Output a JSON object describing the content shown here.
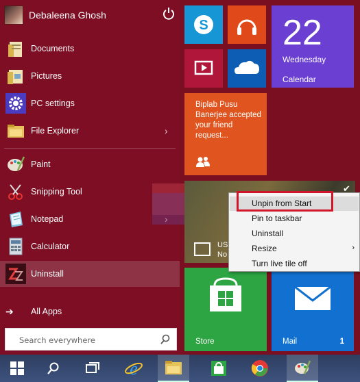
{
  "user": {
    "name": "Debaleena Ghosh"
  },
  "left_items": [
    {
      "label": "Documents",
      "icon": "documents-icon"
    },
    {
      "label": "Pictures",
      "icon": "pictures-icon"
    },
    {
      "label": "PC settings",
      "icon": "gear-icon"
    },
    {
      "label": "File Explorer",
      "icon": "file-explorer-icon"
    },
    {
      "label": "Paint",
      "icon": "paint-icon"
    },
    {
      "label": "Snipping Tool",
      "icon": "snipping-tool-icon"
    },
    {
      "label": "Notepad",
      "icon": "notepad-icon"
    },
    {
      "label": "Calculator",
      "icon": "calculator-icon"
    },
    {
      "label": "Uninstall",
      "icon": "uninstall-icon"
    }
  ],
  "all_apps": {
    "label": "All Apps"
  },
  "search": {
    "placeholder": "Search everywhere"
  },
  "tiles": {
    "calendar": {
      "date": "22",
      "day": "Wednesday",
      "name": "Calendar"
    },
    "people": {
      "text": "Biplab Pusu Banerjee accepted your friend request..."
    },
    "news": {
      "line1": "US",
      "line2": "No"
    },
    "store": {
      "name": "Store"
    },
    "mail": {
      "name": "Mail",
      "badge": "1"
    }
  },
  "context_menu": {
    "items": [
      {
        "label": "Unpin from Start"
      },
      {
        "label": "Pin to taskbar"
      },
      {
        "label": "Uninstall"
      },
      {
        "label": "Resize"
      },
      {
        "label": "Turn live tile off"
      }
    ]
  },
  "colors": {
    "start_bg": "#7d0e24",
    "calendar": "#6a3fd1",
    "people": "#e0551f",
    "store": "#2ca542",
    "mail": "#1271d0",
    "highlight_box": "#d1162a"
  }
}
